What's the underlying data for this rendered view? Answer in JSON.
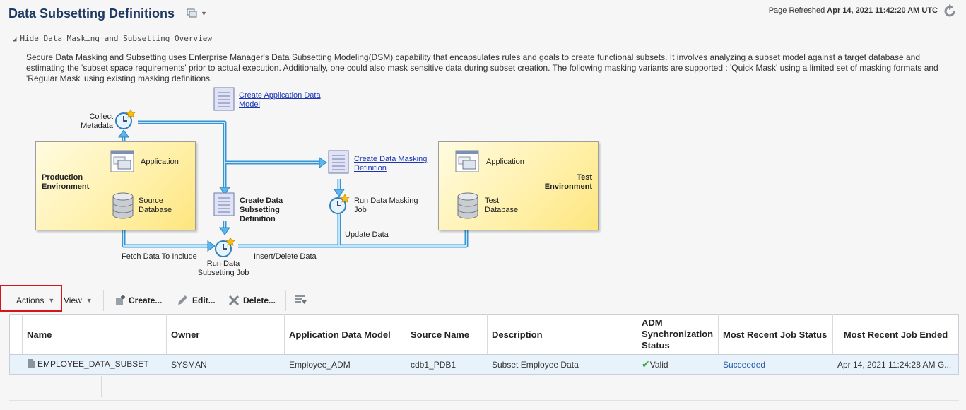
{
  "header": {
    "title": "Data Subsetting Definitions",
    "refresh_label": "Page Refreshed",
    "refresh_time": "Apr 14, 2021 11:42:20 AM UTC"
  },
  "overview": {
    "toggle_label": "Hide Data Masking and Subsetting Overview",
    "description": "Secure Data Masking and Subsetting uses Enterprise Manager's Data Subsetting Modeling(DSM) capability that encapsulates rules and goals to create functional subsets. It involves analyzing a subset model against a target database and estimating the 'subset space requirements' prior to actual execution. Additionally, one could also mask sensitive data during subset creation. The following masking variants are supported : 'Quick Mask' using a limited set of masking formats and 'Regular Mask' using existing masking definitions."
  },
  "diagram": {
    "collect_1": "Collect",
    "collect_2": "Metadata",
    "prod_app": "Application",
    "prod_env_1": "Production",
    "prod_env_2": "Environment",
    "prod_src_1": "Source",
    "prod_src_2": "Database",
    "create_adm_1": "Create Application Data",
    "create_adm_2": "Model",
    "create_mask_1": "Create Data Masking",
    "create_mask_2": "Definition",
    "run_mask_1": "Run Data Masking",
    "run_mask_2": "Job",
    "create_subset_1": "Create Data",
    "create_subset_2": "Subsetting",
    "create_subset_3": "Definition",
    "update_data": "Update Data",
    "fetch_data": "Fetch Data To Include",
    "insert_delete": "Insert/Delete Data",
    "run_subset_1": "Run Data",
    "run_subset_2": "Subsetting Job",
    "test_app": "Application",
    "test_env_1": "Test",
    "test_env_2": "Environment",
    "test_db_1": "Test",
    "test_db_2": "Database"
  },
  "toolbar": {
    "actions": "Actions",
    "view": "View",
    "create": "Create...",
    "edit": "Edit...",
    "delete": "Delete..."
  },
  "table": {
    "columns": {
      "name": "Name",
      "owner": "Owner",
      "adm": "Application Data Model",
      "source": "Source Name",
      "description": "Description",
      "sync_1": "ADM",
      "sync_2": "Synchronization",
      "sync_3": "Status",
      "job_status": "Most Recent Job Status",
      "job_ended": "Most Recent Job Ended"
    },
    "rows": [
      {
        "name": "EMPLOYEE_DATA_SUBSET",
        "owner": "SYSMAN",
        "adm": "Employee_ADM",
        "source": "cdb1_PDB1",
        "description": "Subset Employee Data",
        "sync": "Valid",
        "job_status": "Succeeded",
        "job_ended": "Apr 14, 2021 11:24:28 AM G..."
      }
    ]
  }
}
